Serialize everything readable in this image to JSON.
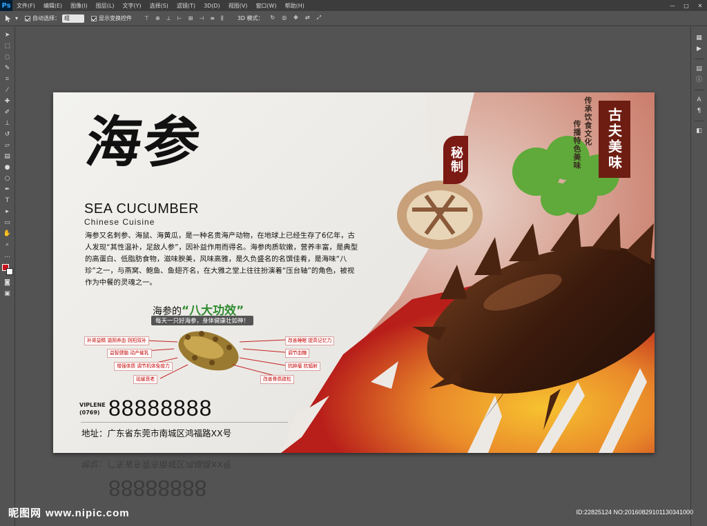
{
  "app": {
    "logo": "Ps"
  },
  "menubar": {
    "items": [
      "文件(F)",
      "编辑(E)",
      "图像(I)",
      "图层(L)",
      "文字(Y)",
      "选择(S)",
      "滤镜(T)",
      "3D(D)",
      "视图(V)",
      "窗口(W)",
      "帮助(H)"
    ],
    "window_controls": [
      "—",
      "□",
      "✕"
    ]
  },
  "options": {
    "auto_select_label": "自动选择：",
    "auto_select_value": "组",
    "show_transform_label": "显示变换控件",
    "mode_3d_label": "3D 模式："
  },
  "poster": {
    "title_cn": "海参",
    "title_en": "SEA CUCUMBER",
    "subtitle_en": "Chinese  Cuisine",
    "description": "海参又名刺参、海鼠、海黄瓜，是一种名贵海产动物，在地球上已经生存了6亿年，古人发现“其性温补，足敌人参”，因补益作用而得名。海参肉质软嫩，营养丰富，是典型的高蛋白、低脂肪食物，滋味腴美，风味高雅，是久负盛名的名馔佳肴，是海味“八珍”之一，与燕窝、鲍鱼、鱼翅齐名，在大雅之堂上往往扮演着“压台轴”的角色，被视作为中餐的灵魂之一。",
    "benefits_title_prefix": "海参的",
    "benefits_title_emphasis": "“八大功效”",
    "benefits_subtitle": "每天一只好海参，身体健康壮如神！",
    "benefits_left": [
      "补肾益精 滋阴养血 则阳双补",
      "益智健脑 动产催乳",
      "增强体质 调节机体免疫力",
      "延缓衰老"
    ],
    "benefits_right": [
      "改善睡眠 提高记忆力",
      "调节血糖",
      "抗肿瘤 抗辐射",
      "改善骨质疏松"
    ],
    "phone_label_1": "VIPLENE",
    "phone_label_2": "(0769)",
    "phone": "88888888",
    "address": "地址：广东省东莞市南城区鸿福路XX号",
    "badge_secret": "秘制",
    "badge_classic": "古夫美味",
    "vertical_1": "传承饮食文化",
    "vertical_2": "传播特色美味"
  },
  "footer": {
    "watermark": "昵图网",
    "watermark_url": "www.nipic.com",
    "image_id": "ID:22825124 NO:20160829101130341000"
  },
  "colors": {
    "accent_red": "#7b1a13",
    "benefit_green": "#2e8b2e",
    "tag_red": "#c40000"
  }
}
